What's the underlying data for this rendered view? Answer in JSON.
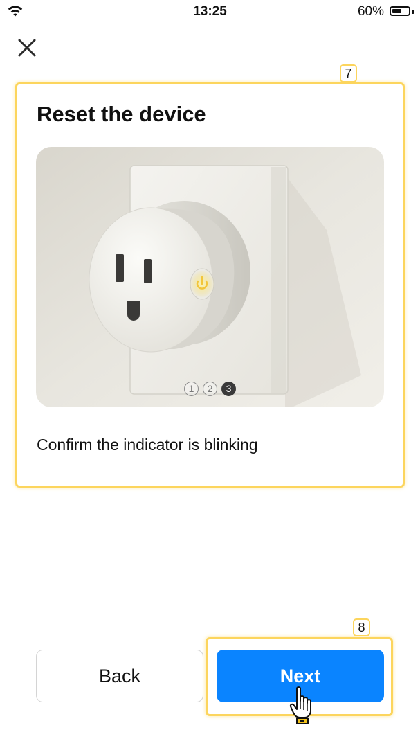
{
  "status_bar": {
    "time": "13:25",
    "battery_percent_label": "60%",
    "battery_level": 0.6
  },
  "header": {
    "close_icon": "close-icon"
  },
  "card": {
    "title": "Reset the device",
    "image": "smart-plug-photo",
    "description": "Confirm the indicator is blinking",
    "carousel": {
      "pages": [
        "1",
        "2",
        "3"
      ],
      "active_index": 2
    }
  },
  "footer": {
    "back_label": "Back",
    "next_label": "Next"
  },
  "annotations": {
    "card_tag": "7",
    "next_tag": "8"
  },
  "colors": {
    "accent": "#0a84ff",
    "highlight": "#fcd55d"
  }
}
